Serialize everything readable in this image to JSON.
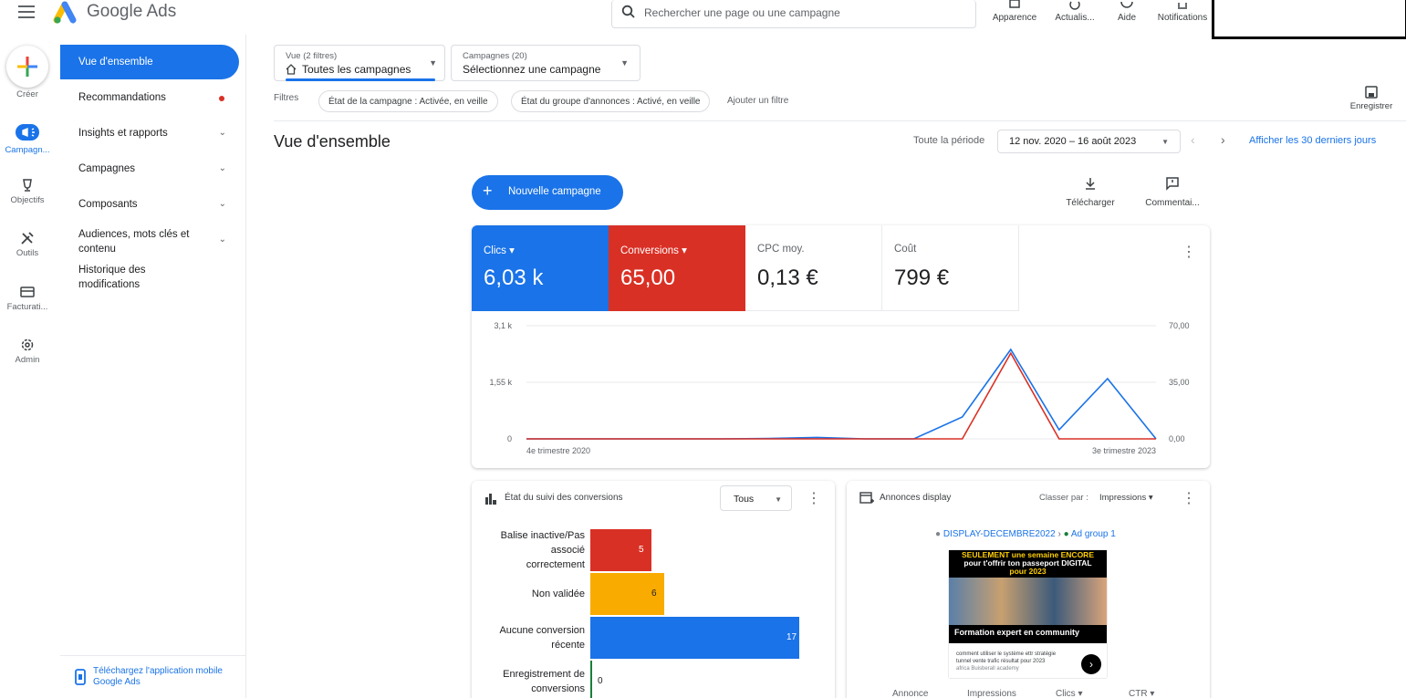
{
  "app": {
    "name": "Google Ads"
  },
  "search": {
    "placeholder": "Rechercher une page ou une campagne"
  },
  "toolbar": {
    "appearance": "Apparence",
    "refresh": "Actualis...",
    "help": "Aide",
    "notifications": "Notifications"
  },
  "rail": {
    "create": "Créer",
    "campaigns": "Campagn...",
    "goals": "Objectifs",
    "tools": "Outils",
    "billing": "Facturati...",
    "admin": "Admin"
  },
  "nav": {
    "items": [
      "Vue d'ensemble",
      "Recommandations",
      "Insights et rapports",
      "Campagnes",
      "Composants",
      "Audiences, mots clés et",
      "contenu",
      "Historique des",
      "modifications"
    ],
    "mobile_app_line1": "Téléchargez l'application mobile",
    "mobile_app_line2": "Google Ads"
  },
  "filters": {
    "view_label": "Vue (2 filtres)",
    "view_value": "Toutes les campagnes",
    "campaigns_label": "Campagnes (20)",
    "campaigns_value": "Sélectionnez une campagne",
    "filters_label": "Filtres",
    "chip1": "État de la campagne : Activée, en veille",
    "chip2": "État du groupe d'annonces : Activé, en veille",
    "add_filter": "Ajouter un filtre",
    "save": "Enregistrer"
  },
  "overview": {
    "title": "Vue d'ensemble",
    "period_label": "Toute la période",
    "date_range": "12 nov. 2020 – 16 août 2023",
    "last30": "Afficher les 30 derniers jours",
    "new_campaign": "Nouvelle campagne",
    "download": "Télécharger",
    "comments": "Commentai..."
  },
  "metrics": [
    {
      "label": "Clics",
      "value": "6,03 k",
      "color": "#1a73e8"
    },
    {
      "label": "Conversions",
      "value": "65,00",
      "color": "#d93025"
    },
    {
      "label": "CPC moy.",
      "value": "0,13 €"
    },
    {
      "label": "Coût",
      "value": "799 €"
    }
  ],
  "chart_data": [
    {
      "type": "line",
      "x_labels": [
        "4e trimestre 2020",
        "3e trimestre 2023"
      ],
      "y_left_ticks": [
        "0",
        "1,55 k",
        "3,1 k"
      ],
      "y_right_ticks": [
        "0,00",
        "35,00",
        "70,00"
      ],
      "ylim_left": [
        0,
        3100
      ],
      "ylim_right": [
        0,
        70
      ],
      "series": [
        {
          "name": "Clics",
          "color": "#1a73e8",
          "axis": "left",
          "values": [
            0,
            0,
            0,
            0,
            0,
            10,
            40,
            0,
            0,
            600,
            2450,
            250,
            1650,
            0
          ]
        },
        {
          "name": "Conversions",
          "color": "#d93025",
          "axis": "right",
          "values": [
            0,
            0,
            0,
            0,
            0,
            0,
            0,
            0,
            0,
            0,
            53,
            0,
            0,
            0
          ]
        }
      ]
    },
    {
      "type": "bar",
      "title": "État du suivi des conversions",
      "orientation": "horizontal",
      "categories": [
        "Balise inactive/Pas associé correctement",
        "Non validée",
        "Aucune conversion récente",
        "Enregistrement de conversions"
      ],
      "category_lines": [
        [
          "Balise inactive/Pas",
          "associé",
          "correctement"
        ],
        [
          "Non validée"
        ],
        [
          "Aucune conversion",
          "récente"
        ],
        [
          "Enregistrement de",
          "conversions"
        ]
      ],
      "values": [
        5,
        6,
        17,
        0
      ],
      "colors": [
        "#d93025",
        "#f9ab00",
        "#1a73e8",
        "#188038"
      ]
    }
  ],
  "conversion_card": {
    "title": "État du suivi des conversions",
    "filter_value": "Tous"
  },
  "display_card": {
    "title": "Annonces display",
    "sort_label": "Classer par :",
    "sort_value": "Impressions",
    "campaign": "DISPLAY-DECEMBRE2022",
    "ad_group": "Ad group 1",
    "ad_headline1": "SEULEMENT une semaine ENCORE",
    "ad_headline2": "pour t'offrir ton passeport DIGITAL",
    "ad_headline3": "pour 2023",
    "ad_banner": "Formation expert en community",
    "ad_desc1": "comment utiliser le système ettr stratégie",
    "ad_desc2": "tunnel vente trafic résultat pour 2023",
    "ad_brand": "africa Buisberall academy",
    "columns": [
      "Annonce",
      "Impressions",
      "Clics",
      "CTR"
    ]
  }
}
